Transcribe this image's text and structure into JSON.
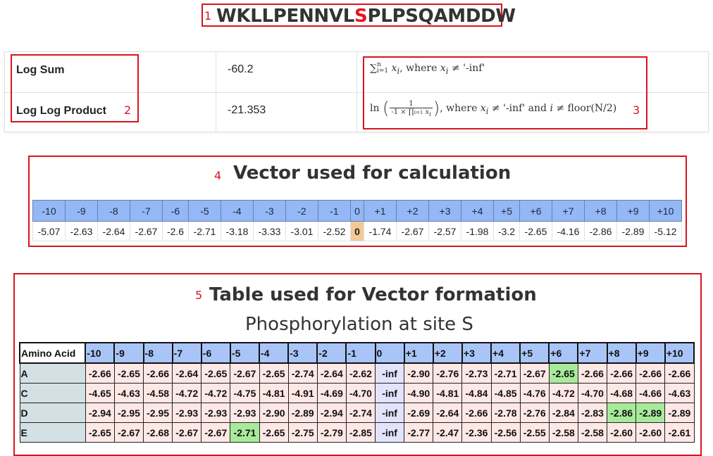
{
  "sequence": {
    "number": "1",
    "before": "WKLLPENNVL",
    "site": "S",
    "after": "PLPSQAMDDW"
  },
  "summary": {
    "label_box_number": "2",
    "formula_box_number": "3",
    "rows": [
      {
        "label": "Log Sum",
        "value": "-60.2"
      },
      {
        "label": "Log Log Product",
        "value": "-21.353"
      }
    ],
    "formula1": {
      "sum": "∑",
      "sup": "n",
      "sub": "i=1",
      "var": "x",
      "idx": "i",
      "text": ", where ",
      "cond": " ≠ '-inf'"
    },
    "formula2": {
      "ln": "ln",
      "num": "1",
      "den_prefix": "-1 × ∏",
      "den_sup": "n",
      "den_sub": "i=1",
      "text": ", where ",
      "cond1": " ≠ '-inf' and ",
      "cond2": " ≠ floor(N/2)"
    }
  },
  "vector_section": {
    "number": "4",
    "title": "Vector used for calculation",
    "headers": [
      "-10",
      "-9",
      "-8",
      "-7",
      "-6",
      "-5",
      "-4",
      "-3",
      "-2",
      "-1",
      "0",
      "+1",
      "+2",
      "+3",
      "+4",
      "+5",
      "+6",
      "+7",
      "+8",
      "+9",
      "+10"
    ],
    "values": [
      "-5.07",
      "-2.63",
      "-2.64",
      "-2.67",
      "-2.6",
      "-2.71",
      "-3.18",
      "-3.33",
      "-3.01",
      "-2.52",
      "0",
      "-1.74",
      "-2.67",
      "-2.57",
      "-1.98",
      "-3.2",
      "-2.65",
      "-4.16",
      "-2.86",
      "-2.89",
      "-5.12"
    ]
  },
  "table_section": {
    "number": "5",
    "title": "Table used for Vector formation",
    "subtitle": "Phosphorylation at site S",
    "corner": "Amino Acid",
    "headers": [
      "-10",
      "-9",
      "-8",
      "-7",
      "-6",
      "-5",
      "-4",
      "-3",
      "-2",
      "-1",
      "0",
      "+1",
      "+2",
      "+3",
      "+4",
      "+5",
      "+6",
      "+7",
      "+8",
      "+9",
      "+10"
    ],
    "rows": [
      {
        "aa": "A",
        "values": [
          "-2.66",
          "-2.65",
          "-2.66",
          "-2.64",
          "-2.65",
          "-2.67",
          "-2.65",
          "-2.74",
          "-2.64",
          "-2.62",
          "-inf",
          "-2.90",
          "-2.76",
          "-2.73",
          "-2.71",
          "-2.67",
          "-2.65",
          "-2.66",
          "-2.66",
          "-2.66",
          "-2.66"
        ],
        "highlight": [
          16
        ]
      },
      {
        "aa": "C",
        "values": [
          "-4.65",
          "-4.63",
          "-4.58",
          "-4.72",
          "-4.72",
          "-4.75",
          "-4.81",
          "-4.91",
          "-4.69",
          "-4.70",
          "-inf",
          "-4.90",
          "-4.81",
          "-4.84",
          "-4.85",
          "-4.76",
          "-4.72",
          "-4.70",
          "-4.68",
          "-4.66",
          "-4.63"
        ],
        "highlight": []
      },
      {
        "aa": "D",
        "values": [
          "-2.94",
          "-2.95",
          "-2.95",
          "-2.93",
          "-2.93",
          "-2.93",
          "-2.90",
          "-2.89",
          "-2.94",
          "-2.74",
          "-inf",
          "-2.69",
          "-2.64",
          "-2.66",
          "-2.78",
          "-2.76",
          "-2.84",
          "-2.83",
          "-2.86",
          "-2.89",
          "-2.89"
        ],
        "highlight": [
          18,
          19
        ]
      },
      {
        "aa": "E",
        "values": [
          "-2.65",
          "-2.67",
          "-2.68",
          "-2.67",
          "-2.67",
          "-2.71",
          "-2.65",
          "-2.75",
          "-2.79",
          "-2.85",
          "-inf",
          "-2.77",
          "-2.47",
          "-2.36",
          "-2.56",
          "-2.55",
          "-2.58",
          "-2.58",
          "-2.60",
          "-2.60",
          "-2.61"
        ],
        "highlight": [
          5
        ]
      }
    ]
  }
}
